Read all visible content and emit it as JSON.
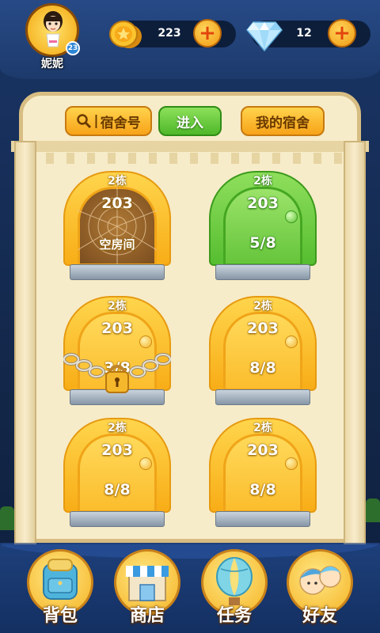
{
  "user": {
    "name": "妮妮",
    "level": "23"
  },
  "resources": {
    "coins": "223",
    "gems": "12",
    "plus": "+"
  },
  "toolbar": {
    "search_label": "宿舍号",
    "search_prefix": "|",
    "enter_label": "进入",
    "my_dorm_label": "我的宿舍"
  },
  "dorms": [
    {
      "building": "2栋",
      "room": "203",
      "status": "空房间",
      "occupancy": "",
      "style": "empty"
    },
    {
      "building": "2栋",
      "room": "203",
      "occupancy": "5/8",
      "style": "green"
    },
    {
      "building": "2栋",
      "room": "203",
      "occupancy": "3/8",
      "style": "locked"
    },
    {
      "building": "2栋",
      "room": "203",
      "occupancy": "8/8",
      "style": "yellow"
    },
    {
      "building": "2栋",
      "room": "203",
      "occupancy": "8/8",
      "style": "yellow"
    },
    {
      "building": "2栋",
      "room": "203",
      "occupancy": "8/8",
      "style": "yellow"
    }
  ],
  "nav": {
    "bag": "背包",
    "shop": "商店",
    "task": "任务",
    "friends": "好友"
  },
  "colors": {
    "accent_orange": "#f7a319",
    "accent_green": "#4fb82a",
    "board_bg": "#f7ecc9",
    "nav_bg": "#143062"
  }
}
